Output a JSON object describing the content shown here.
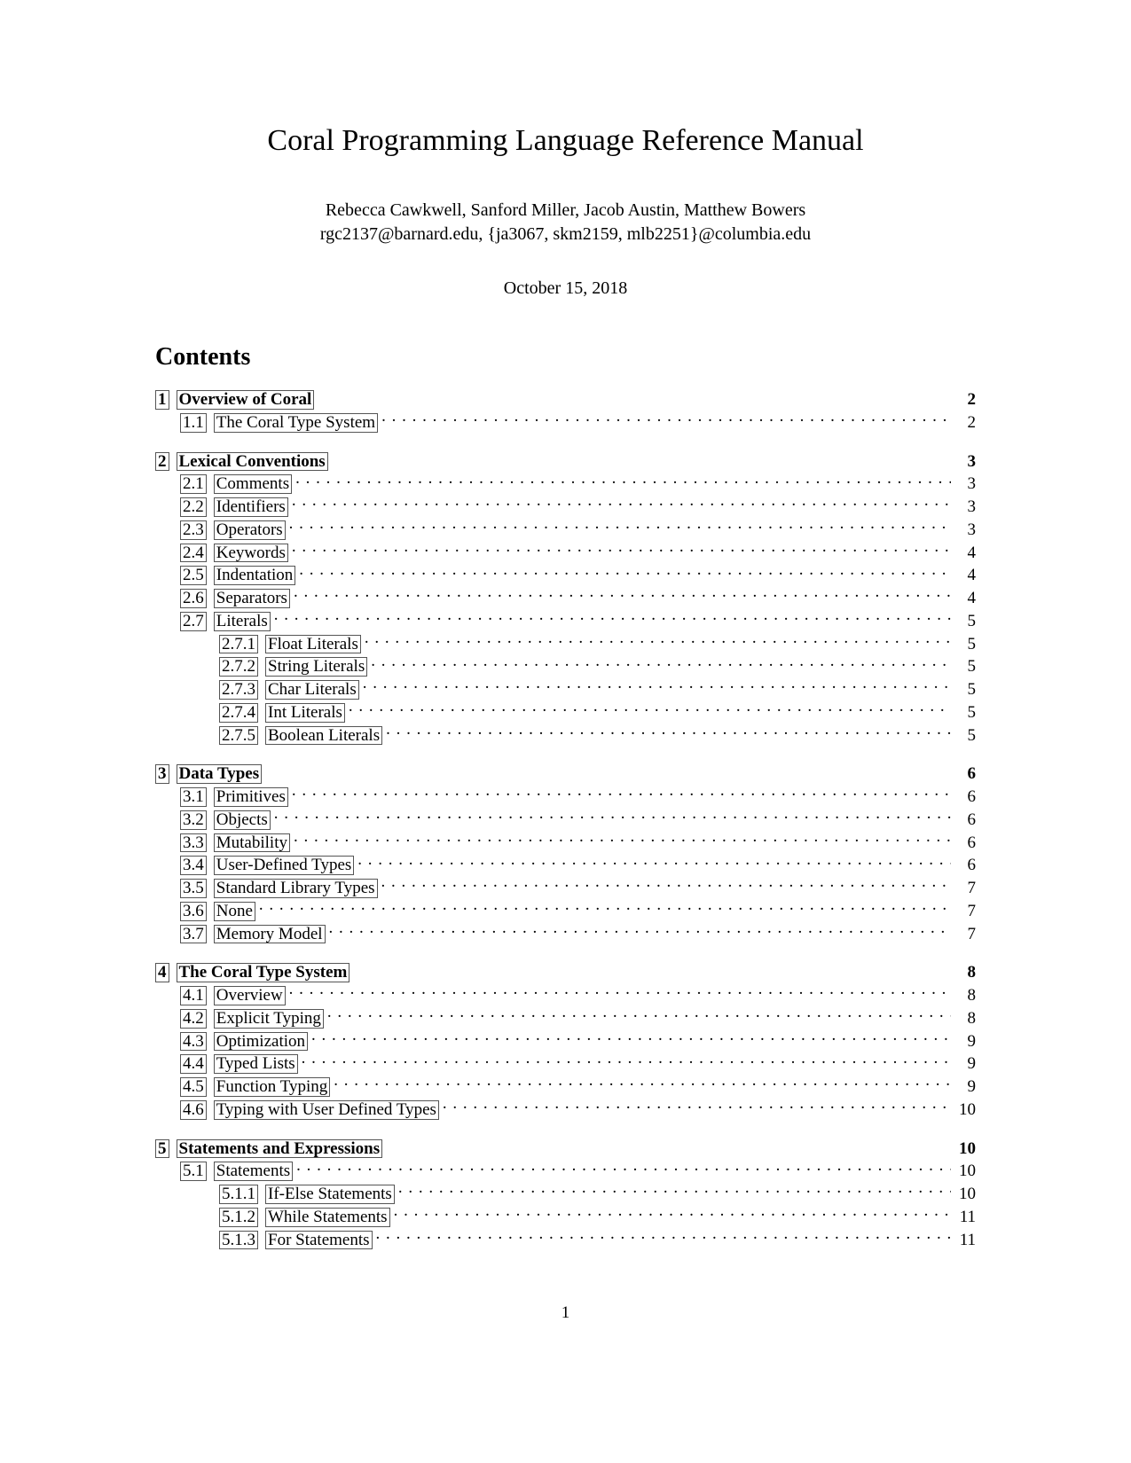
{
  "title": "Coral Programming Language Reference Manual",
  "authors_line1": "Rebecca Cawkwell, Sanford Miller, Jacob Austin, Matthew Bowers",
  "authors_line2": "rgc2137@barnard.edu, {ja3067, skm2159, mlb2251}@columbia.edu",
  "date": "October 15, 2018",
  "contents_label": "Contents",
  "page_number": "1",
  "toc": [
    {
      "num": "1",
      "title": "Overview of Coral",
      "page": "2",
      "children": [
        {
          "num": "1.1",
          "title": "The Coral Type System",
          "page": "2"
        }
      ]
    },
    {
      "num": "2",
      "title": "Lexical Conventions",
      "page": "3",
      "children": [
        {
          "num": "2.1",
          "title": "Comments",
          "page": "3"
        },
        {
          "num": "2.2",
          "title": "Identifiers",
          "page": "3"
        },
        {
          "num": "2.3",
          "title": "Operators",
          "page": "3"
        },
        {
          "num": "2.4",
          "title": "Keywords",
          "page": "4"
        },
        {
          "num": "2.5",
          "title": "Indentation",
          "page": "4"
        },
        {
          "num": "2.6",
          "title": "Separators",
          "page": "4"
        },
        {
          "num": "2.7",
          "title": "Literals",
          "page": "5",
          "children": [
            {
              "num": "2.7.1",
              "title": "Float Literals",
              "page": "5"
            },
            {
              "num": "2.7.2",
              "title": "String Literals",
              "page": "5"
            },
            {
              "num": "2.7.3",
              "title": "Char Literals",
              "page": "5"
            },
            {
              "num": "2.7.4",
              "title": "Int Literals",
              "page": "5"
            },
            {
              "num": "2.7.5",
              "title": "Boolean Literals",
              "page": "5"
            }
          ]
        }
      ]
    },
    {
      "num": "3",
      "title": "Data Types",
      "page": "6",
      "children": [
        {
          "num": "3.1",
          "title": "Primitives",
          "page": "6"
        },
        {
          "num": "3.2",
          "title": "Objects",
          "page": "6"
        },
        {
          "num": "3.3",
          "title": "Mutability",
          "page": "6"
        },
        {
          "num": "3.4",
          "title": "User-Defined Types",
          "page": "6"
        },
        {
          "num": "3.5",
          "title": "Standard Library Types",
          "page": "7"
        },
        {
          "num": "3.6",
          "title": "None",
          "page": "7"
        },
        {
          "num": "3.7",
          "title": "Memory Model",
          "page": "7"
        }
      ]
    },
    {
      "num": "4",
      "title": "The Coral Type System",
      "page": "8",
      "children": [
        {
          "num": "4.1",
          "title": "Overview",
          "page": "8"
        },
        {
          "num": "4.2",
          "title": "Explicit Typing",
          "page": "8"
        },
        {
          "num": "4.3",
          "title": "Optimization",
          "page": "9"
        },
        {
          "num": "4.4",
          "title": "Typed Lists",
          "page": "9"
        },
        {
          "num": "4.5",
          "title": "Function Typing",
          "page": "9"
        },
        {
          "num": "4.6",
          "title": "Typing with User Defined Types",
          "page": "10"
        }
      ]
    },
    {
      "num": "5",
      "title": "Statements and Expressions",
      "page": "10",
      "children": [
        {
          "num": "5.1",
          "title": "Statements",
          "page": "10",
          "children": [
            {
              "num": "5.1.1",
              "title": "If-Else Statements",
              "page": "10"
            },
            {
              "num": "5.1.2",
              "title": "While Statements",
              "page": "11"
            },
            {
              "num": "5.1.3",
              "title": "For Statements",
              "page": "11"
            }
          ]
        }
      ]
    }
  ]
}
